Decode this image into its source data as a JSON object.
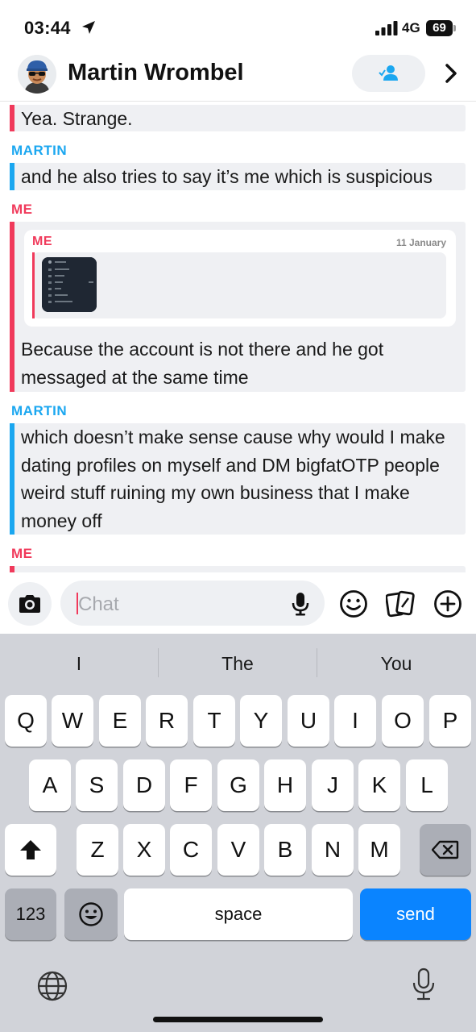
{
  "status_bar": {
    "time": "03:44",
    "network": "4G",
    "battery": "69"
  },
  "header": {
    "contact_name": "Martin Wrombel"
  },
  "messages": [
    {
      "sender": "",
      "side": "me",
      "text": "Yea. Strange."
    },
    {
      "sender": "MARTIN",
      "side": "martin",
      "text": "and he also tries to say it’s me which is suspicious"
    },
    {
      "sender": "ME",
      "side": "me",
      "quote": {
        "sender": "ME",
        "date": "11 January"
      },
      "text": "Because the account is not there and he got messaged at the same time"
    },
    {
      "sender": "MARTIN",
      "side": "martin",
      "text": "which doesn’t make sense cause why would I make dating profiles on myself and DM bigfatOTP people weird stuff ruining my own business that I make money off"
    },
    {
      "sender": "ME",
      "side": "me",
      "text": ""
    }
  ],
  "composer": {
    "placeholder": "Chat"
  },
  "keyboard": {
    "suggestions": [
      "I",
      "The",
      "You"
    ],
    "row1": [
      "Q",
      "W",
      "E",
      "R",
      "T",
      "Y",
      "U",
      "I",
      "O",
      "P"
    ],
    "row2": [
      "A",
      "S",
      "D",
      "F",
      "G",
      "H",
      "J",
      "K",
      "L"
    ],
    "row3": [
      "Z",
      "X",
      "C",
      "V",
      "B",
      "N",
      "M"
    ],
    "numbers_label": "123",
    "space_label": "space",
    "send_label": "send"
  },
  "colors": {
    "me_accent": "#f03a5b",
    "martin_accent": "#1ba7f0",
    "send_blue": "#0a84ff"
  }
}
